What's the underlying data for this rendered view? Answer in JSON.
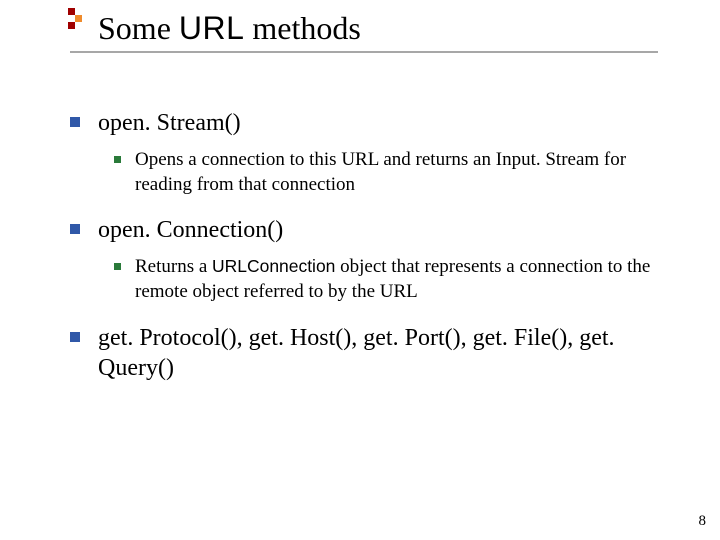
{
  "title": {
    "pre": "Some ",
    "mono": "URL",
    "post": " methods"
  },
  "items": [
    {
      "label": "open. Stream()",
      "children": [
        {
          "text": "Opens a connection to this URL and returns an Input. Stream for reading from that connection"
        }
      ]
    },
    {
      "label": "open. Connection()",
      "children": [
        {
          "pre": "Returns a ",
          "mono": "URLConnection",
          "post": " object that represents a connection to the remote object referred to by the URL"
        }
      ]
    },
    {
      "label": "get. Protocol(), get. Host(), get. Port(), get. File(), get. Query()"
    }
  ],
  "page_number": "8"
}
